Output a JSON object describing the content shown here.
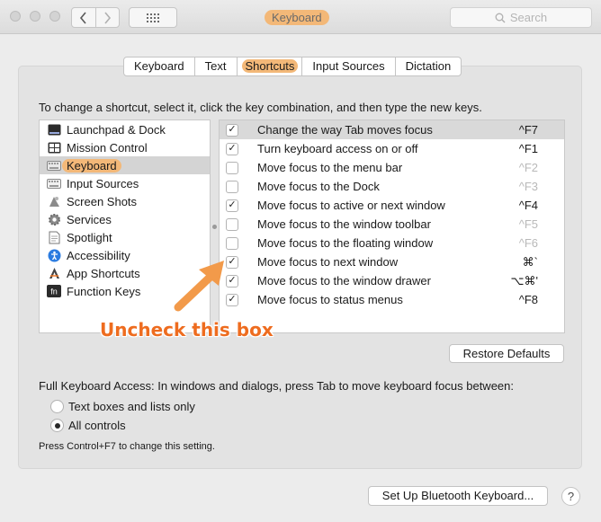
{
  "window": {
    "title": "Keyboard",
    "search_placeholder": "Search",
    "back_icon": "chevron-left-icon",
    "forward_icon": "chevron-right-icon",
    "show_all_icon": "grid-icon"
  },
  "tabs": [
    {
      "label": "Keyboard",
      "active": false
    },
    {
      "label": "Text",
      "active": false
    },
    {
      "label": "Shortcuts",
      "active": true
    },
    {
      "label": "Input Sources",
      "active": false
    },
    {
      "label": "Dictation",
      "active": false
    }
  ],
  "instruction": "To change a shortcut, select it, click the key combination, and then type the new keys.",
  "categories": [
    {
      "label": "Launchpad & Dock",
      "icon": "launchpad-icon",
      "selected": false
    },
    {
      "label": "Mission Control",
      "icon": "mission-control-icon",
      "selected": false
    },
    {
      "label": "Keyboard",
      "icon": "keyboard-icon",
      "selected": true
    },
    {
      "label": "Input Sources",
      "icon": "input-sources-icon",
      "selected": false
    },
    {
      "label": "Screen Shots",
      "icon": "screenshot-icon",
      "selected": false
    },
    {
      "label": "Services",
      "icon": "gear-icon",
      "selected": false
    },
    {
      "label": "Spotlight",
      "icon": "spotlight-icon",
      "selected": false
    },
    {
      "label": "Accessibility",
      "icon": "accessibility-icon",
      "selected": false
    },
    {
      "label": "App Shortcuts",
      "icon": "app-shortcuts-icon",
      "selected": false
    },
    {
      "label": "Function Keys",
      "icon": "fn-icon",
      "selected": false
    }
  ],
  "shortcuts": [
    {
      "label": "Change the way Tab moves focus",
      "key": "^F7",
      "checked": true,
      "enabled": true,
      "selected": true
    },
    {
      "label": "Turn keyboard access on or off",
      "key": "^F1",
      "checked": true,
      "enabled": true,
      "selected": false
    },
    {
      "label": "Move focus to the menu bar",
      "key": "^F2",
      "checked": false,
      "enabled": false,
      "selected": false
    },
    {
      "label": "Move focus to the Dock",
      "key": "^F3",
      "checked": false,
      "enabled": false,
      "selected": false
    },
    {
      "label": "Move focus to active or next window",
      "key": "^F4",
      "checked": true,
      "enabled": true,
      "selected": false
    },
    {
      "label": "Move focus to the window toolbar",
      "key": "^F5",
      "checked": false,
      "enabled": false,
      "selected": false
    },
    {
      "label": "Move focus to the floating window",
      "key": "^F6",
      "checked": false,
      "enabled": false,
      "selected": false
    },
    {
      "label": "Move focus to next window",
      "key": "⌘`",
      "checked": true,
      "enabled": true,
      "selected": false
    },
    {
      "label": "Move focus to the window drawer",
      "key": "⌥⌘'",
      "checked": true,
      "enabled": true,
      "selected": false
    },
    {
      "label": "Move focus to status menus",
      "key": "^F8",
      "checked": true,
      "enabled": true,
      "selected": false
    }
  ],
  "restore_defaults": "Restore Defaults",
  "full_keyboard_access": {
    "label": "Full Keyboard Access: In windows and dialogs, press Tab to move keyboard focus between:",
    "options": [
      {
        "label": "Text boxes and lists only",
        "selected": false
      },
      {
        "label": "All controls",
        "selected": true
      }
    ],
    "hint": "Press Control+F7 to change this setting."
  },
  "bluetooth_button": "Set Up Bluetooth Keyboard...",
  "help_button": "?",
  "annotation": {
    "text": "Uncheck this box",
    "color": "#ee6c1f"
  },
  "colors": {
    "highlight": "#f3b878",
    "annotation": "#ee6c1f"
  }
}
